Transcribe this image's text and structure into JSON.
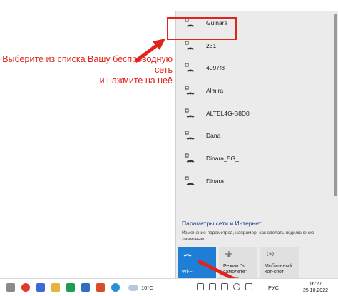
{
  "annotation": {
    "text_line1": "Выберите из списка Вашу беспроводную сеть",
    "text_line2": "и нажмите на неё"
  },
  "networks": [
    {
      "name": "Gulnara"
    },
    {
      "name": "231"
    },
    {
      "name": "4097f8"
    },
    {
      "name": "Almira"
    },
    {
      "name": "ALTEL4G-B8D0"
    },
    {
      "name": "Dana"
    },
    {
      "name": "Dinara_5G_"
    },
    {
      "name": "Dinara"
    }
  ],
  "settings": {
    "link": "Параметры сети и Интернет",
    "description": "Изменение параметров, например, как сделать подключение лимитным."
  },
  "quick_actions": {
    "wifi": "Wi-Fi",
    "airplane": "Режим \"в самолете\"",
    "hotspot": "Мобильный хот-спот"
  },
  "taskbar": {
    "weather": "10°C",
    "language": "РУС",
    "time": "16:27",
    "date": "25.10.2022"
  },
  "colors": {
    "highlight": "#e3241b",
    "accent": "#1f7fd6"
  }
}
